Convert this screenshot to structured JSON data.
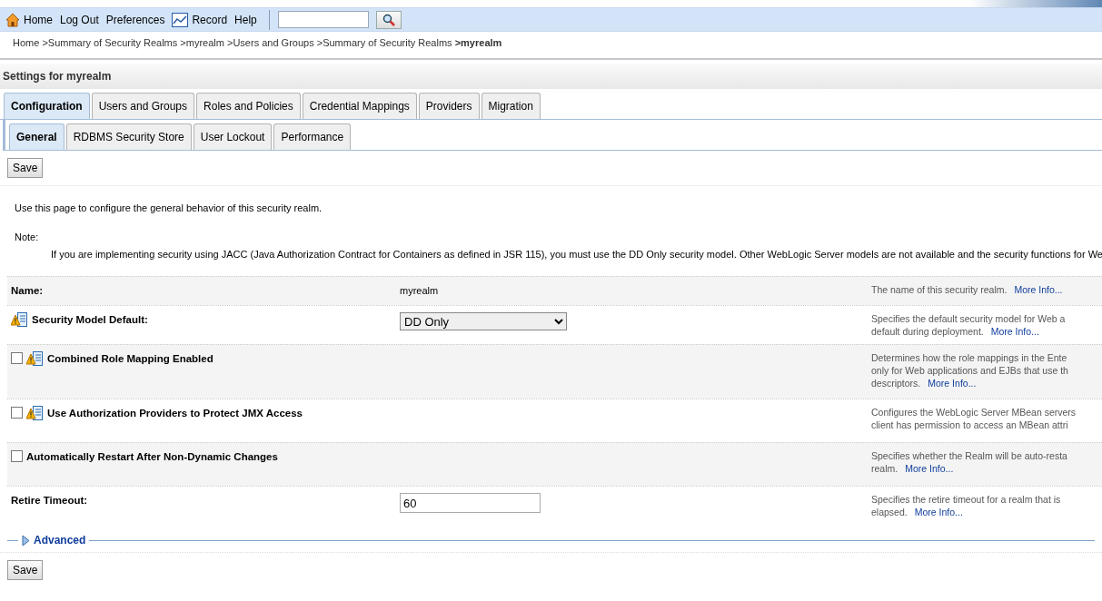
{
  "toolbar": {
    "items": [
      {
        "label": "Home"
      },
      {
        "label": "Log Out"
      },
      {
        "label": "Preferences"
      },
      {
        "label": "Record"
      },
      {
        "label": "Help"
      }
    ]
  },
  "breadcrumb": [
    {
      "label": "Home",
      "current": false
    },
    {
      "label": ">Summary of Security Realms",
      "current": false
    },
    {
      "label": ">myrealm",
      "current": false
    },
    {
      "label": ">Users and Groups",
      "current": false
    },
    {
      "label": ">Summary of Security Realms",
      "current": false
    },
    {
      "label": ">myrealm",
      "current": true
    }
  ],
  "page_title": "Settings for myrealm",
  "tabs": [
    {
      "label": "Configuration",
      "selected": true
    },
    {
      "label": "Users and Groups",
      "selected": false
    },
    {
      "label": "Roles and Policies",
      "selected": false
    },
    {
      "label": "Credential Mappings",
      "selected": false
    },
    {
      "label": "Providers",
      "selected": false
    },
    {
      "label": "Migration",
      "selected": false
    }
  ],
  "subtabs": [
    {
      "label": "General",
      "selected": true
    },
    {
      "label": "RDBMS Security Store",
      "selected": false
    },
    {
      "label": "User Lockout",
      "selected": false
    },
    {
      "label": "Performance",
      "selected": false
    }
  ],
  "save_top": "Save",
  "intro": "Use this page to configure the general behavior of this security realm.",
  "note_label": "Note:",
  "note": "If you are implementing security using JACC (Java Authorization Contract for Containers as defined in JSR 115), you must use the DD Only security model. Other WebLogic Server models are not available and the security functions for We",
  "fields": [
    {
      "kind": "text",
      "label": "Name:",
      "restart_icon": false,
      "value": "myrealm",
      "description": [
        "The name of this security realm."
      ],
      "more": "More Info..."
    },
    {
      "kind": "select",
      "label": "Security Model Default:",
      "restart_icon": true,
      "value": "DD Only",
      "description": [
        "Specifies the default security model for Web a",
        "default during deployment."
      ],
      "more": "More Info..."
    },
    {
      "kind": "checkbox",
      "label": "Combined Role Mapping Enabled",
      "restart_icon": true,
      "checked": false,
      "description": [
        "Determines how the role mappings in the Ente",
        "only for Web applications and EJBs that use th",
        "descriptors."
      ],
      "more": "More Info..."
    },
    {
      "kind": "checkbox",
      "label": "Use Authorization Providers to Protect JMX Access",
      "restart_icon": true,
      "checked": false,
      "description": [
        "Configures the WebLogic Server MBean servers",
        "client has permission to access an MBean attri"
      ]
    },
    {
      "kind": "checkbox",
      "label": "Automatically Restart After Non-Dynamic Changes",
      "restart_icon": false,
      "checked": false,
      "description": [
        "Specifies whether the Realm will be auto-resta",
        "realm."
      ],
      "more": "More Info..."
    },
    {
      "kind": "input",
      "label": "Retire Timeout:",
      "restart_icon": false,
      "value": "60",
      "description": [
        "Specifies the retire timeout for a realm that is",
        "elapsed."
      ],
      "more": "More Info..."
    }
  ],
  "advanced": {
    "label": "Advanced",
    "expanded": false
  },
  "save_bottom": "Save"
}
